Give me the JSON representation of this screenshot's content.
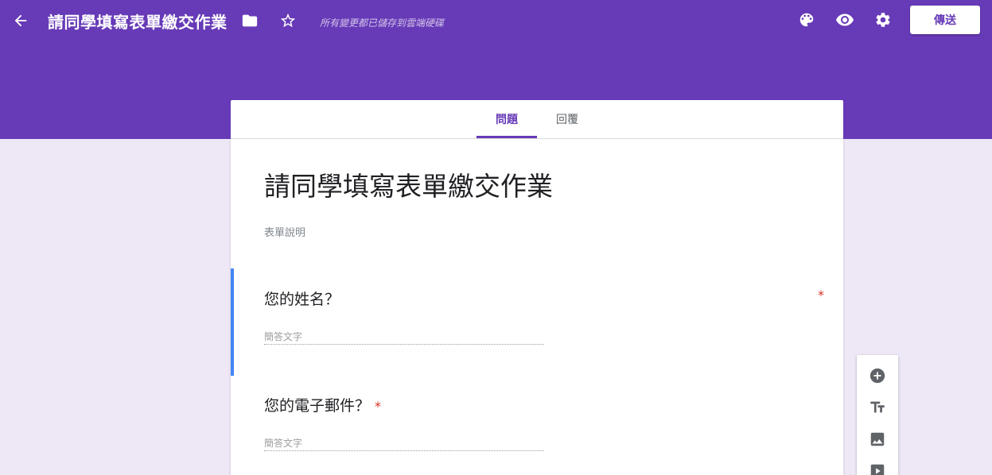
{
  "header": {
    "title": "請同學填寫表單繳交作業",
    "save_status": "所有變更都已儲存到雲端硬碟",
    "send_label": "傳送"
  },
  "tabs": [
    {
      "label": "問題"
    },
    {
      "label": "回覆"
    }
  ],
  "form": {
    "title": "請同學填寫表單繳交作業",
    "description": "表單說明",
    "questions": [
      {
        "text": "您的姓名？",
        "placeholder": "簡答文字",
        "required_mark": "*"
      },
      {
        "text": "您的電子郵件？",
        "placeholder": "簡答文字",
        "required_mark": "*"
      }
    ]
  },
  "icons": {
    "back": "arrow-back-icon",
    "folder": "folder-icon",
    "star": "star-outline-icon",
    "palette": "palette-icon",
    "preview": "eye-icon",
    "settings": "gear-icon",
    "add_question": "add-circle-icon",
    "add_title": "title-text-icon",
    "add_image": "image-icon",
    "add_video": "video-icon"
  },
  "colors": {
    "header_bg": "#673ab7",
    "page_bg": "#ede7f6",
    "active_question_bar": "#4285f4",
    "required": "#d93025"
  }
}
